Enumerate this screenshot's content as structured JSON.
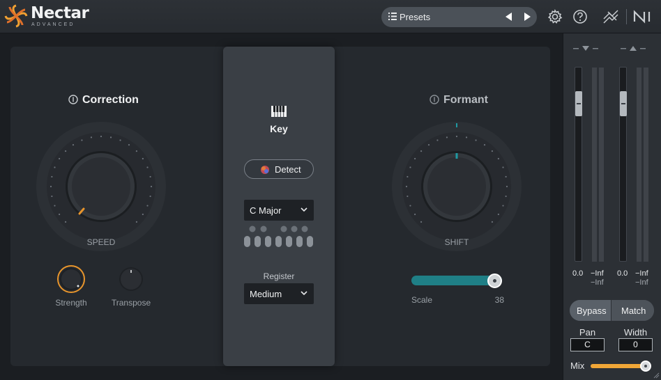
{
  "header": {
    "brand": "Nectar",
    "brand_sub": "ADVANCED",
    "presets_label": "Presets",
    "icons": [
      "list-icon",
      "prev-arrow-icon",
      "next-arrow-icon",
      "settings-gear-icon",
      "help-icon",
      "signal-routing-icon",
      "ni-logo-icon"
    ]
  },
  "correction": {
    "title": "Correction",
    "knob_label": "SPEED",
    "strength_label": "Strength",
    "transpose_label": "Transpose",
    "accent": "#e8952c"
  },
  "key": {
    "title": "Key",
    "detect_label": "Detect",
    "scale_value": "C Major",
    "register_label": "Register",
    "register_value": "Medium"
  },
  "formant": {
    "title": "Formant",
    "knob_label": "SHIFT",
    "scale_label": "Scale",
    "scale_value": "38",
    "accent": "#1f7f86"
  },
  "meters": {
    "input_gain": "0.0",
    "input_peak": "−Inf",
    "input_peak_2": "−Inf",
    "output_gain": "0.0",
    "output_peak": "−Inf",
    "output_peak_2": "−Inf"
  },
  "controls": {
    "bypass_label": "Bypass",
    "match_label": "Match",
    "pan_label": "Pan",
    "pan_value": "C",
    "width_label": "Width",
    "width_value": "0",
    "mix_label": "Mix",
    "mix_accent": "#f0a637"
  }
}
